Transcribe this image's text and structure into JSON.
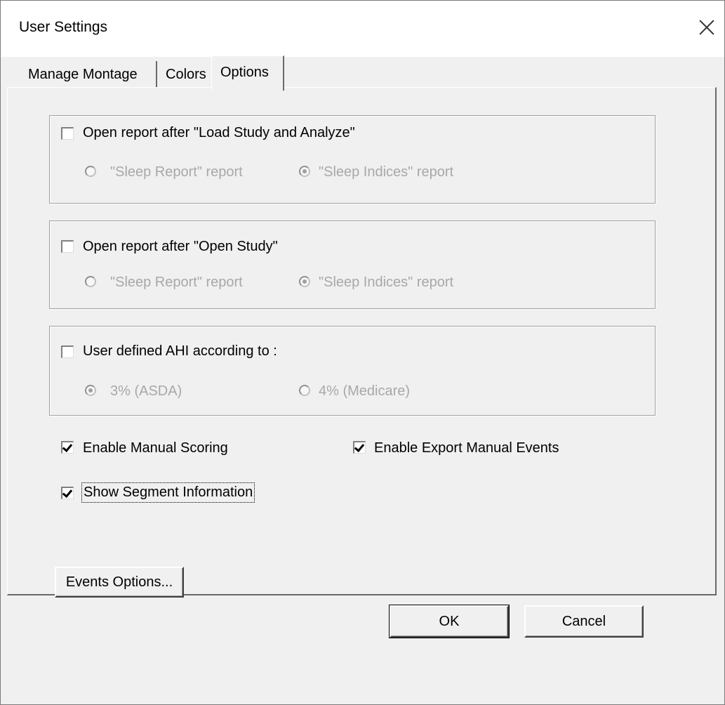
{
  "window": {
    "title": "User Settings"
  },
  "tabs": [
    {
      "label": "Manage Montage",
      "active": false
    },
    {
      "label": "Colors",
      "active": false
    },
    {
      "label": "Options",
      "active": true
    }
  ],
  "groups": [
    {
      "checkbox_label": "Open report after  \"Load Study and Analyze\"",
      "checked": false,
      "options": [
        {
          "label": "\"Sleep Report\" report",
          "selected": false
        },
        {
          "label": "\"Sleep Indices\" report",
          "selected": true
        }
      ]
    },
    {
      "checkbox_label": "Open report after  \"Open Study\"",
      "checked": false,
      "options": [
        {
          "label": "\"Sleep Report\" report",
          "selected": false
        },
        {
          "label": "\"Sleep Indices\" report",
          "selected": true
        }
      ]
    },
    {
      "checkbox_label": "User defined AHI according to :",
      "checked": false,
      "options": [
        {
          "label": "3% (ASDA)",
          "selected": true
        },
        {
          "label": "4% (Medicare)",
          "selected": false
        }
      ]
    }
  ],
  "checkboxes": {
    "manual_scoring": {
      "label": "Enable Manual Scoring",
      "checked": true
    },
    "export_manual_events": {
      "label": "Enable Export Manual Events",
      "checked": true
    },
    "segment_info": {
      "label": "Show Segment Information",
      "checked": true
    }
  },
  "buttons": {
    "events_options": "Events Options...",
    "ok": "OK",
    "cancel": "Cancel"
  }
}
